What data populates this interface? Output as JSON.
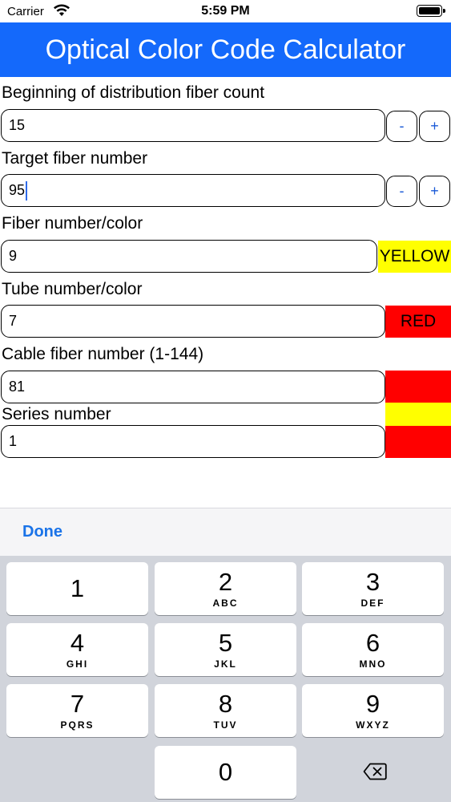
{
  "status_bar": {
    "carrier": "Carrier",
    "time": "5:59 PM"
  },
  "nav": {
    "title": "Optical Color Code Calculator"
  },
  "form": {
    "beginning": {
      "label": "Beginning of distribution fiber count",
      "value": "15",
      "minus": "-",
      "plus": "+"
    },
    "target": {
      "label": "Target fiber number",
      "value": "95",
      "minus": "-",
      "plus": "+"
    },
    "fiber": {
      "label": "Fiber number/color",
      "value": "9",
      "color_name": "YELLOW"
    },
    "tube": {
      "label": "Tube number/color",
      "value": "7",
      "color_name": "RED"
    },
    "cable": {
      "label": "Cable fiber number (1-144)",
      "value": "81"
    },
    "series": {
      "label": "Series number",
      "value": "1"
    }
  },
  "colors": {
    "nav": "#1469fb",
    "yellow": "#ffff00",
    "red": "#ff0000",
    "accent": "#1a73e8"
  },
  "keyboard": {
    "done": "Done",
    "keys": [
      {
        "digit": "1",
        "letters": ""
      },
      {
        "digit": "2",
        "letters": "ABC"
      },
      {
        "digit": "3",
        "letters": "DEF"
      },
      {
        "digit": "4",
        "letters": "GHI"
      },
      {
        "digit": "5",
        "letters": "JKL"
      },
      {
        "digit": "6",
        "letters": "MNO"
      },
      {
        "digit": "7",
        "letters": "PQRS"
      },
      {
        "digit": "8",
        "letters": "TUV"
      },
      {
        "digit": "9",
        "letters": "WXYZ"
      },
      {
        "digit": "0",
        "letters": ""
      }
    ],
    "delete_icon": "backspace-icon"
  }
}
